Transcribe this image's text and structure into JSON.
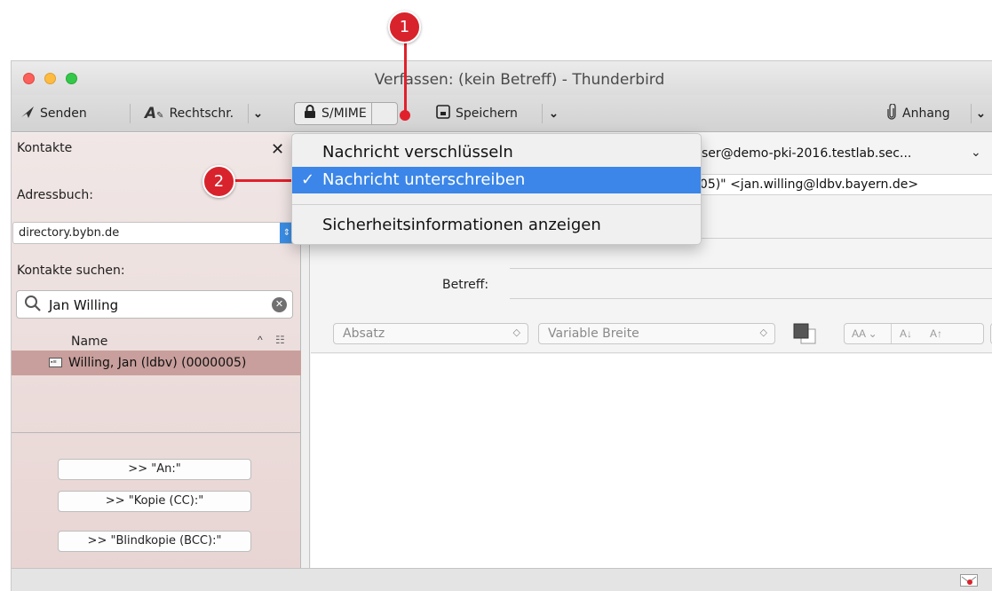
{
  "window": {
    "title": "Verfassen: (kein Betreff) - Thunderbird"
  },
  "toolbar": {
    "send_label": "Senden",
    "spell_label": "Rechtschr.",
    "smime_label": "S/MIME",
    "save_label": "Speichern",
    "attach_label": "Anhang"
  },
  "sidebar": {
    "title": "Kontakte",
    "addressbook_label": "Adressbuch:",
    "addressbook_value": "directory.bybn.de",
    "search_label": "Kontakte suchen:",
    "search_value": "Jan Willing",
    "column_name": "Name",
    "contacts": [
      {
        "name": "Willing, Jan (ldbv) (0000005)"
      }
    ],
    "buttons": {
      "to": ">> \"An:\"",
      "cc": ">> \"Kopie (CC):\"",
      "bcc": ">> \"Blindkopie (BCC):\""
    }
  },
  "compose": {
    "from_value": "ser@demo-pki-2016.testlab.sec...",
    "to_value": "005)\" <jan.willing@ldbv.bayern.de>",
    "subject_label": "Betreff:",
    "paragraph_format": "Absatz",
    "font": "Variable Breite"
  },
  "menu": {
    "items": [
      {
        "label": "Nachricht verschlüsseln",
        "checked": false
      },
      {
        "label": "Nachricht unterschreiben",
        "checked": true,
        "check_glyph": "✓"
      },
      {
        "label": "Sicherheitsinformationen anzeigen",
        "checked": false
      }
    ]
  },
  "callouts": {
    "one": "1",
    "two": "2"
  },
  "colors": {
    "callout_red": "#d8232c",
    "menu_highlight": "#3b86e8",
    "sidebar_selection": "#c89f9c"
  }
}
